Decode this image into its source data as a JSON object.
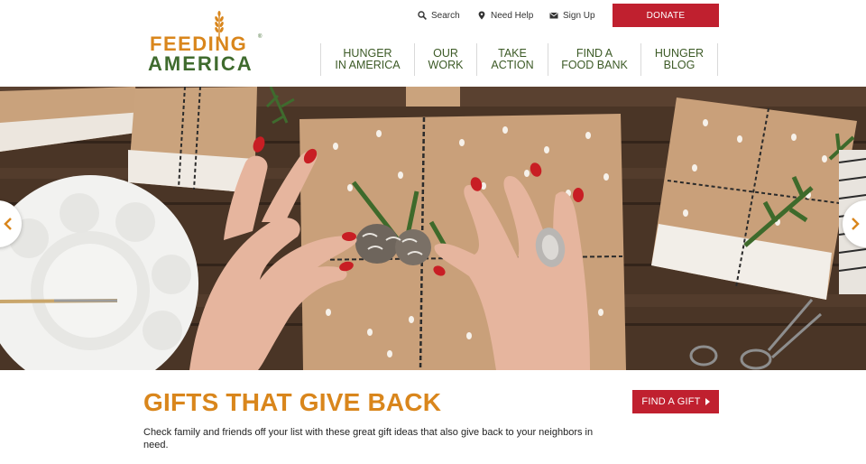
{
  "logo": {
    "line1": "FEEDING",
    "line2": "AMERICA",
    "registered": "®",
    "icon": "wheat-icon"
  },
  "utility_nav": {
    "search": {
      "label": "Search",
      "icon": "search-icon"
    },
    "help": {
      "label": "Need Help",
      "icon": "map-pin-icon"
    },
    "signup": {
      "label": "Sign Up",
      "icon": "envelope-icon"
    }
  },
  "donate_label": "DONATE",
  "main_nav": [
    {
      "line1": "HUNGER",
      "line2": "IN AMERICA"
    },
    {
      "line1": "OUR",
      "line2": "WORK"
    },
    {
      "line1": "TAKE",
      "line2": "ACTION"
    },
    {
      "line1": "FIND A",
      "line2": "FOOD BANK"
    },
    {
      "line1": "HUNGER",
      "line2": "BLOG"
    }
  ],
  "hero": {
    "prev_icon": "chevron-left-icon",
    "next_icon": "chevron-right-icon"
  },
  "promo": {
    "title": "GIFTS THAT GIVE BACK",
    "text": "Check family and friends off your list with these great gift ideas that also give back to your neighbors in need.",
    "cta_label": "FIND A GIFT",
    "cta_icon": "caret-right-icon"
  },
  "colors": {
    "brand_orange": "#d9861c",
    "brand_green": "#3f6b2e",
    "nav_green": "#3c5a26",
    "accent_red": "#c0202f"
  }
}
